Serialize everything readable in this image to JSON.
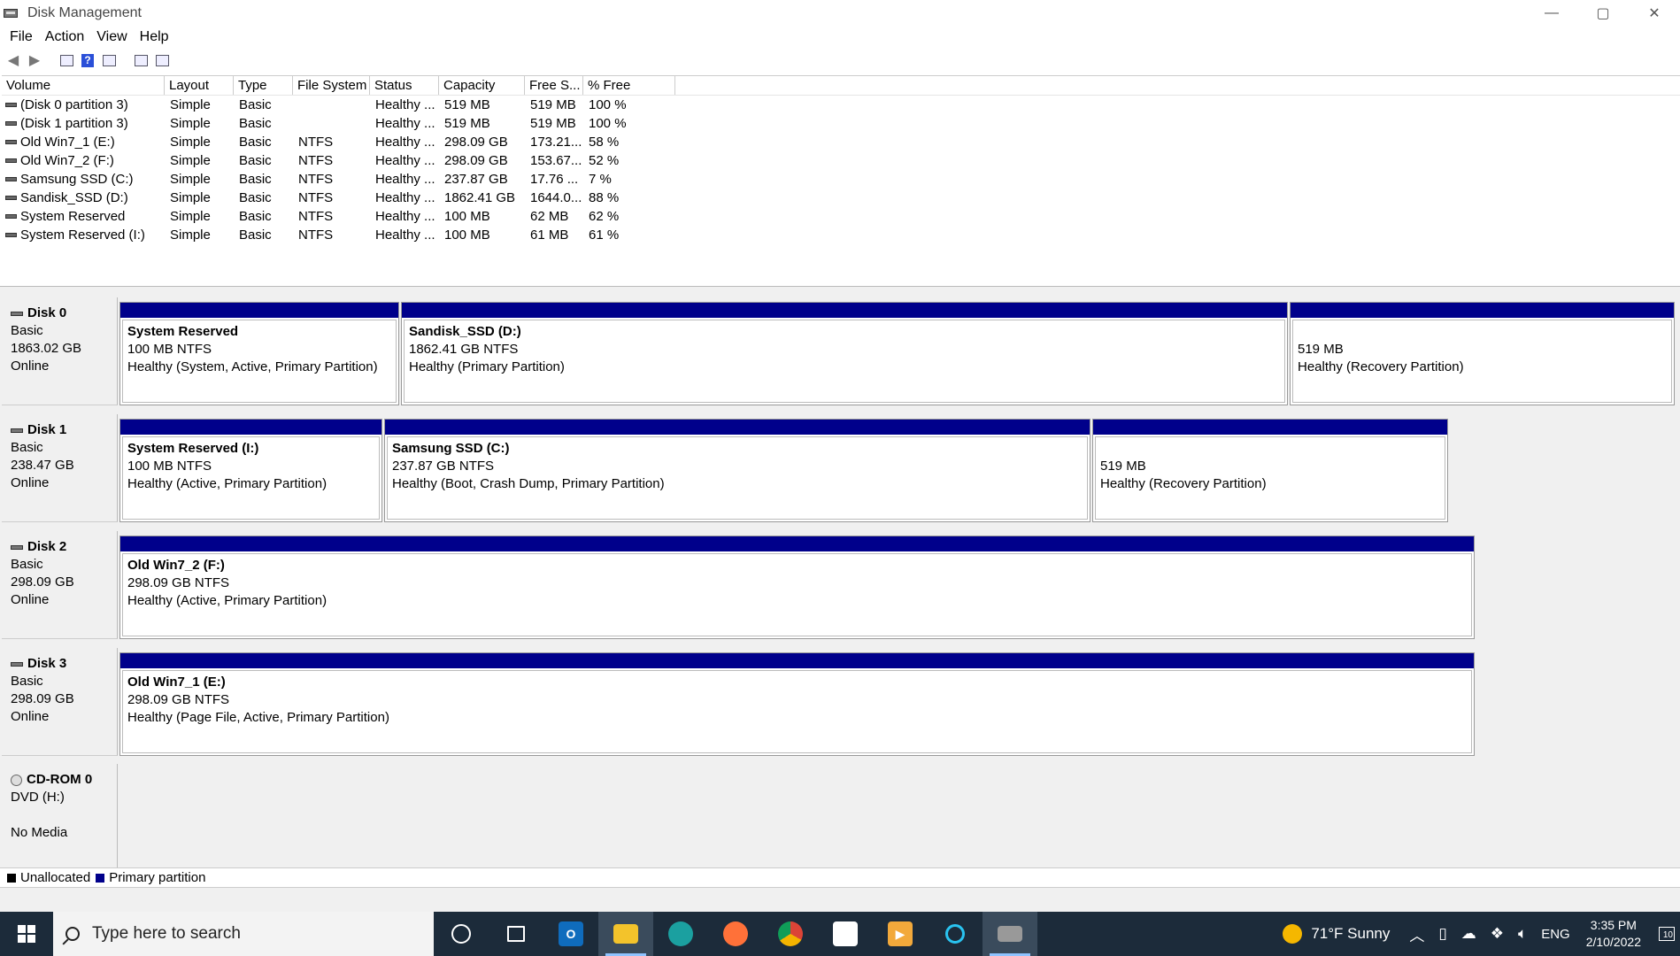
{
  "window": {
    "title": "Disk Management",
    "minimize": "—",
    "maximize": "▢",
    "close": "✕"
  },
  "menu": [
    "File",
    "Action",
    "View",
    "Help"
  ],
  "volume_list": {
    "columns": [
      "Volume",
      "Layout",
      "Type",
      "File System",
      "Status",
      "Capacity",
      "Free S...",
      "% Free"
    ],
    "rows": [
      [
        "(Disk 0 partition 3)",
        "Simple",
        "Basic",
        "",
        "Healthy ...",
        "519 MB",
        "519 MB",
        "100 %"
      ],
      [
        "(Disk 1 partition 3)",
        "Simple",
        "Basic",
        "",
        "Healthy ...",
        "519 MB",
        "519 MB",
        "100 %"
      ],
      [
        "Old Win7_1 (E:)",
        "Simple",
        "Basic",
        "NTFS",
        "Healthy ...",
        "298.09 GB",
        "173.21...",
        "58 %"
      ],
      [
        "Old Win7_2 (F:)",
        "Simple",
        "Basic",
        "NTFS",
        "Healthy ...",
        "298.09 GB",
        "153.67...",
        "52 %"
      ],
      [
        "Samsung SSD (C:)",
        "Simple",
        "Basic",
        "NTFS",
        "Healthy ...",
        "237.87 GB",
        "17.76 ...",
        "7 %"
      ],
      [
        "Sandisk_SSD (D:)",
        "Simple",
        "Basic",
        "NTFS",
        "Healthy ...",
        "1862.41 GB",
        "1644.0...",
        "88 %"
      ],
      [
        "System Reserved",
        "Simple",
        "Basic",
        "NTFS",
        "Healthy ...",
        "100 MB",
        "62 MB",
        "62 %"
      ],
      [
        "System Reserved (I:)",
        "Simple",
        "Basic",
        "NTFS",
        "Healthy ...",
        "100 MB",
        "61 MB",
        "61 %"
      ]
    ]
  },
  "disks": [
    {
      "name": "Disk 0",
      "type": "Basic",
      "size": "1863.02 GB",
      "status": "Online",
      "partitions": [
        {
          "name": "System Reserved",
          "size": "100 MB NTFS",
          "status": "Healthy (System, Active, Primary Partition)"
        },
        {
          "name": "Sandisk_SSD  (D:)",
          "size": "1862.41 GB NTFS",
          "status": "Healthy (Primary Partition)"
        },
        {
          "name": "",
          "size": "519 MB",
          "status": "Healthy (Recovery Partition)"
        }
      ]
    },
    {
      "name": "Disk 1",
      "type": "Basic",
      "size": "238.47 GB",
      "status": "Online",
      "partitions": [
        {
          "name": "System Reserved  (I:)",
          "size": "100 MB NTFS",
          "status": "Healthy (Active, Primary Partition)"
        },
        {
          "name": "Samsung SSD  (C:)",
          "size": "237.87 GB NTFS",
          "status": "Healthy (Boot, Crash Dump, Primary Partition)"
        },
        {
          "name": "",
          "size": "519 MB",
          "status": "Healthy (Recovery Partition)"
        }
      ]
    },
    {
      "name": "Disk 2",
      "type": "Basic",
      "size": "298.09 GB",
      "status": "Online",
      "partitions": [
        {
          "name": "Old Win7_2  (F:)",
          "size": "298.09 GB NTFS",
          "status": "Healthy (Active, Primary Partition)"
        }
      ]
    },
    {
      "name": "Disk 3",
      "type": "Basic",
      "size": "298.09 GB",
      "status": "Online",
      "partitions": [
        {
          "name": "Old Win7_1  (E:)",
          "size": "298.09 GB NTFS",
          "status": "Healthy (Page File, Active, Primary Partition)"
        }
      ]
    }
  ],
  "cdrom": {
    "name": "CD-ROM 0",
    "drive": "DVD (H:)",
    "status": "No Media"
  },
  "legend": {
    "unallocated": "Unallocated",
    "primary": "Primary partition",
    "unallocated_color": "#000000",
    "primary_color": "#00008b"
  },
  "taskbar": {
    "search_placeholder": "Type here to search",
    "apps": [
      "cortana-icon",
      "task-view-icon",
      "outlook-icon",
      "file-explorer-icon",
      "edge-icon",
      "firefox-icon",
      "chrome-icon",
      "store-icon",
      "video-app-icon",
      "alexa-icon",
      "disk-management-icon"
    ],
    "weather": "71°F  Sunny",
    "language": "ENG",
    "time": "3:35 PM",
    "date": "2/10/2022",
    "notifications": "10"
  }
}
